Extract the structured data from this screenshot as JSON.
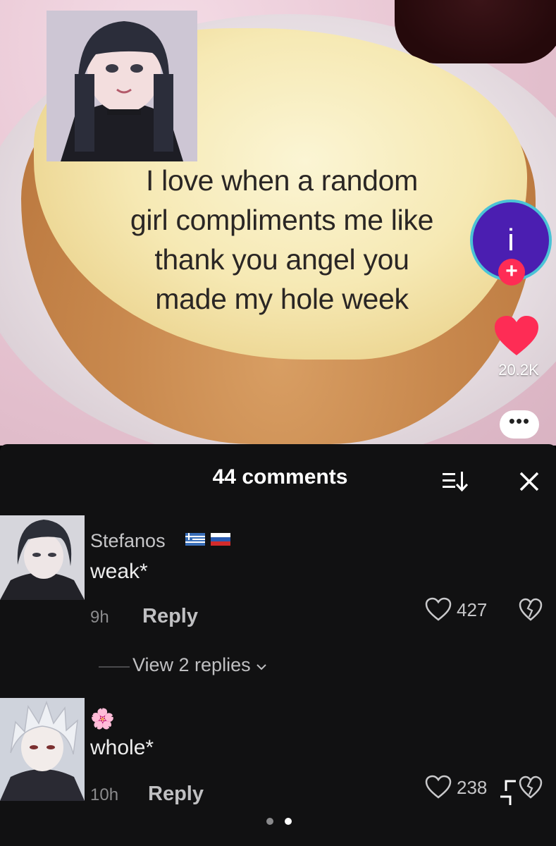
{
  "video": {
    "caption_lines": [
      "I love when a random",
      "girl compliments me like",
      "thank you angel you",
      "made my hole week"
    ],
    "creator_avatar_letter": "i",
    "follow_symbol": "+",
    "like_count": "20.2K",
    "more_symbol": "•••"
  },
  "comments_panel": {
    "title": "44 comments",
    "comments": [
      {
        "author": "Stefanos",
        "flags": [
          "greece-flag",
          "russia-flag"
        ],
        "text": "weak*",
        "time": "9h",
        "reply_label": "Reply",
        "like_count": "427",
        "view_replies": "View 2 replies"
      },
      {
        "author": "🌸",
        "text": "whole*",
        "time": "10h",
        "reply_label": "Reply",
        "like_count": "238"
      }
    ]
  },
  "colors": {
    "panel_bg": "#111112",
    "accent_red": "#fe2c55",
    "creator_purple": "#4b1eb1",
    "ring_cyan": "#4ac3d6"
  },
  "icons": [
    "sort-icon",
    "close-icon",
    "heart-icon",
    "broken-heart-icon",
    "plus-icon",
    "more-icon",
    "chevron-down-icon",
    "crop-icon"
  ]
}
